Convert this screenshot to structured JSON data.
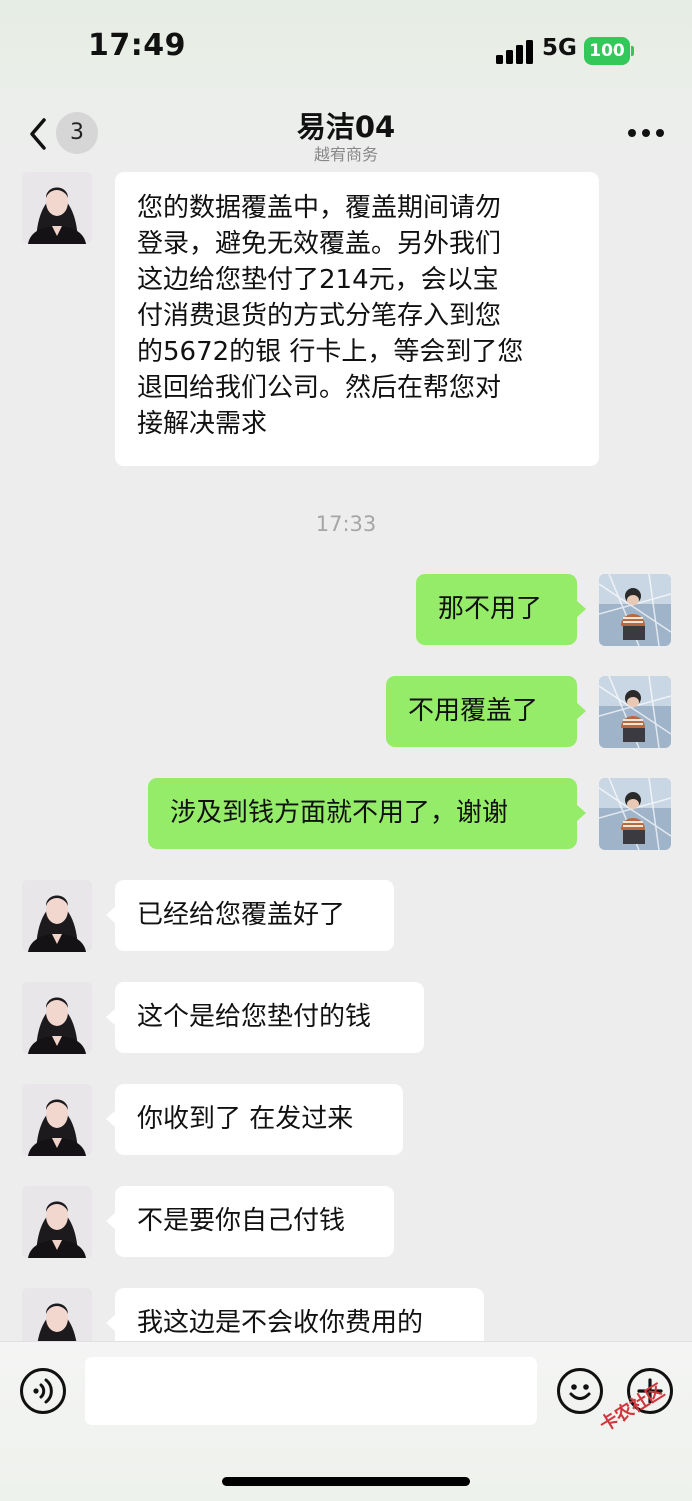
{
  "status_bar": {
    "time": "17:49",
    "network": "5G",
    "battery": "100"
  },
  "nav": {
    "unread_count": "3",
    "title": "易洁04",
    "subtitle": "越宥商务"
  },
  "messages": [
    {
      "from": "contact",
      "lines": [
        "您的数据覆盖中，覆盖期间请勿",
        "登录，避免无效覆盖。另外我们",
        "这边给您垫付了214元，会以宝",
        "付消费退货的方式分笔存入到您",
        "的5672的银 行卡上，等会到了您",
        "退回给我们公司。然后在帮您对",
        "接解决需求"
      ]
    },
    {
      "from": "me",
      "text": "那不用了"
    },
    {
      "from": "me",
      "text": "不用覆盖了"
    },
    {
      "from": "me",
      "text": "涉及到钱方面就不用了，谢谢"
    },
    {
      "from": "contact",
      "text": "已经给您覆盖好了"
    },
    {
      "from": "contact",
      "text": "这个是给您垫付的钱"
    },
    {
      "from": "contact",
      "text": "你收到了 在发过来"
    },
    {
      "from": "contact",
      "text": "不是要你自己付钱"
    },
    {
      "from": "contact",
      "text": "我这边是不会收你费用的"
    }
  ],
  "timestamp": "17:33",
  "input": {
    "value": "",
    "placeholder": ""
  },
  "icons": {
    "back": "chevron-left-icon",
    "more": "more-dots-icon",
    "voice": "voice-icon",
    "emoji": "emoji-icon",
    "add": "plus-icon"
  },
  "watermark": "卡农社区",
  "colors": {
    "outgoing_bubble": "#95EC69",
    "incoming_bubble": "#FFFFFF",
    "background": "#EDEDED",
    "battery": "#34C759"
  }
}
